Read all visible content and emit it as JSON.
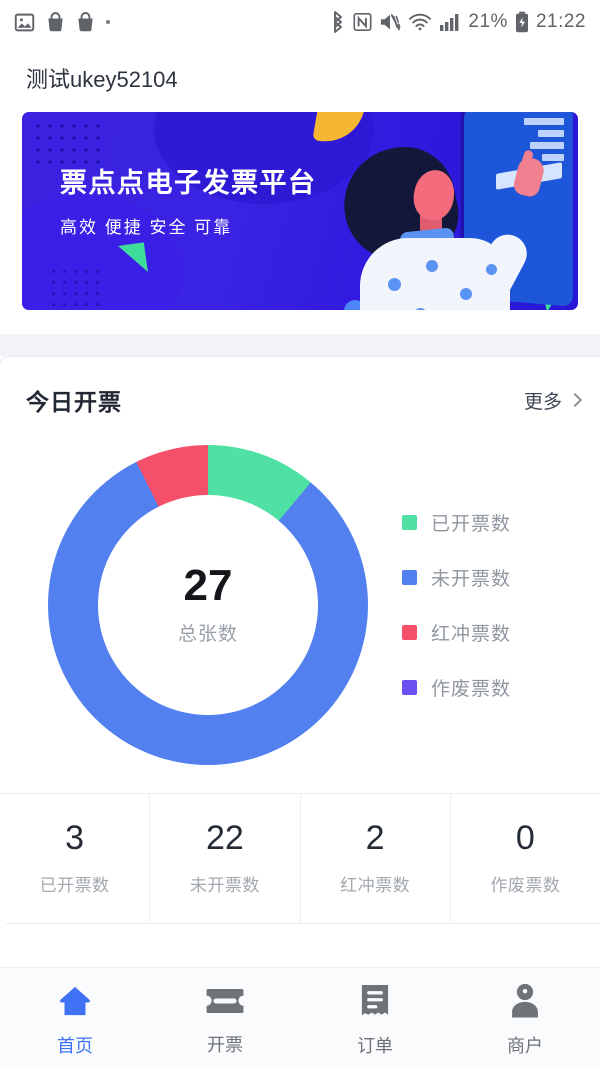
{
  "statusbar": {
    "left_icons": [
      "image-icon",
      "bag-icon",
      "bag-icon",
      "dot-icon"
    ],
    "right_icons": [
      "bluetooth-icon",
      "nfc-icon",
      "mute-icon",
      "wifi-icon",
      "signal-icon"
    ],
    "battery_percent": "21%",
    "battery_icon": "battery-charging-icon",
    "time": "21:22"
  },
  "account": {
    "name": "测试ukey52104"
  },
  "banner": {
    "title": "票点点电子发票平台",
    "subtitle": "高效  便捷  安全  可靠",
    "bg_color": "#3320DF",
    "accent_yellow": "#F5B731",
    "accent_green": "#3DDC9A"
  },
  "card": {
    "title": "今日开票",
    "more_label": "更多",
    "more_icon": "chevron-right-icon"
  },
  "chart_data": {
    "type": "pie",
    "title": "今日开票",
    "center_value": "27",
    "center_label": "总张数",
    "total": 27,
    "categories": [
      "已开票数",
      "未开票数",
      "红冲票数",
      "作废票数"
    ],
    "values": [
      3,
      22,
      2,
      0
    ],
    "colors": [
      "#4FE0A3",
      "#5281EF",
      "#F4506A",
      "#6C4FF0"
    ],
    "legend_position": "right",
    "donut": true,
    "start_angle_deg": 0
  },
  "stats": [
    {
      "value": "3",
      "label": "已开票数"
    },
    {
      "value": "22",
      "label": "未开票数"
    },
    {
      "value": "2",
      "label": "红冲票数"
    },
    {
      "value": "0",
      "label": "作废票数"
    }
  ],
  "bottomnav": [
    {
      "label": "首页",
      "icon": "home-icon",
      "active": true
    },
    {
      "label": "开票",
      "icon": "ticket-icon",
      "active": false
    },
    {
      "label": "订单",
      "icon": "receipt-icon",
      "active": false
    },
    {
      "label": "商户",
      "icon": "person-icon",
      "active": false
    }
  ],
  "theme": {
    "active_color": "#3F72F5",
    "inactive_color": "#6F7378",
    "page_bg": "#FFFFFF",
    "band_bg": "#F1F3F8"
  }
}
